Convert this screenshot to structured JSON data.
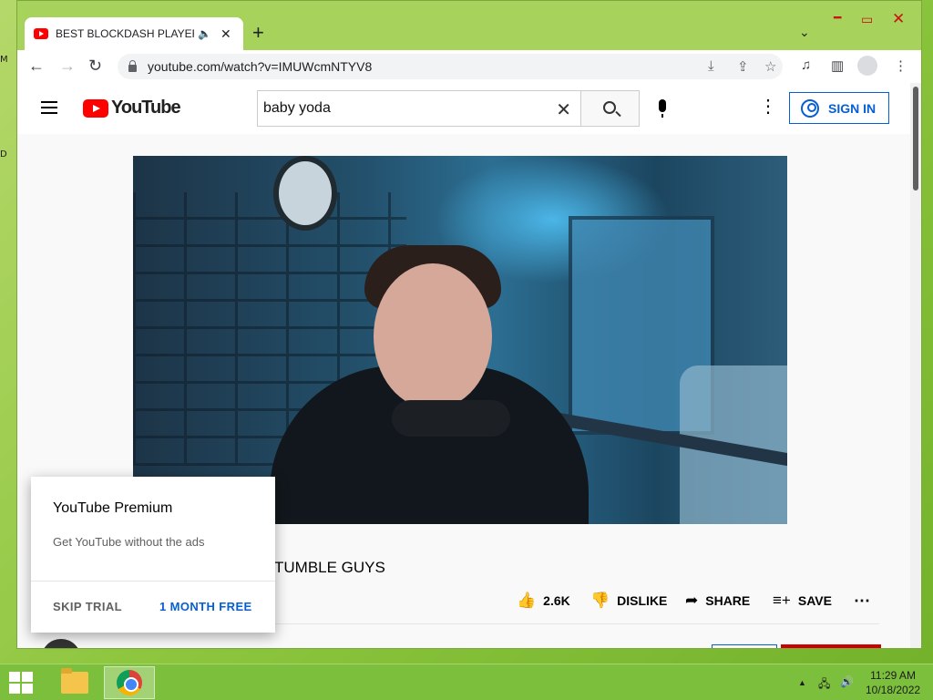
{
  "desktop": {
    "marks": [
      "M",
      "D"
    ]
  },
  "tab": {
    "title": "BEST BLOCKDASH PLAYER IN",
    "audio_icon": "speaker-icon",
    "close": "✕",
    "new": "+"
  },
  "window": {
    "tab_search": "⌄",
    "minimize": "━",
    "maximize": "▭",
    "close": "✕"
  },
  "toolbar": {
    "back": "←",
    "forward": "→",
    "reload": "↻",
    "url": "youtube.com/watch?v=IMUWcmNTYV8",
    "icons": [
      "install-icon",
      "share-icon",
      "bookmark-star-icon",
      "reading-list-icon",
      "side-panel-icon",
      "profile-icon",
      "chrome-menu-icon"
    ],
    "install": "⤓",
    "share": "⇪",
    "star": "☆",
    "media": "♫",
    "sidepanel": "▥",
    "menu": "⋮"
  },
  "youtube": {
    "logo_text": "YouTube",
    "search": {
      "value": "baby yoda",
      "clear": "✕"
    },
    "more": "⋮",
    "sign_in": "SIGN IN"
  },
  "video": {
    "title": "TUMBLE GUYS",
    "actions": {
      "like_icon": "👍",
      "like_count": "2.6K",
      "dislike_icon": "👎",
      "dislike": "DISLIKE",
      "share_icon": "➦",
      "share": "SHARE",
      "save_icon": "≡+",
      "save": "SAVE",
      "more": "⋯"
    }
  },
  "promo": {
    "title": "YouTube Premium",
    "description": "Get YouTube without the ads",
    "skip": "SKIP TRIAL",
    "accept": "1 MONTH FREE"
  },
  "taskbar": {
    "tray_arrow": "▲",
    "network": "🖧",
    "volume": "🔊",
    "time": "11:29 AM",
    "date": "10/18/2022"
  }
}
